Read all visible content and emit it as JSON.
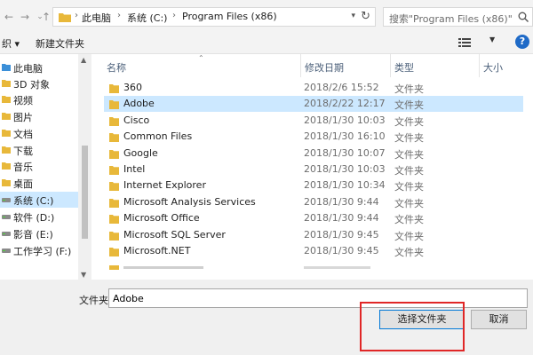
{
  "address": {
    "crumbs": [
      "此电脑",
      "系统 (C:)",
      "Program Files (x86)"
    ],
    "refresh_glyph": "↻"
  },
  "search": {
    "placeholder": "搜索\"Program Files (x86)\""
  },
  "toolbar": {
    "organize_label": "织 ▾",
    "new_folder_label": "新建文件夹",
    "help_glyph": "?"
  },
  "nav": {
    "items": [
      {
        "label": "此电脑",
        "icon": "computer-icon",
        "selected": false
      },
      {
        "label": "3D 对象",
        "icon": "3d-objects-icon",
        "selected": false
      },
      {
        "label": "视频",
        "icon": "video-folder-icon",
        "selected": false
      },
      {
        "label": "图片",
        "icon": "pictures-folder-icon",
        "selected": false
      },
      {
        "label": "文档",
        "icon": "documents-folder-icon",
        "selected": false
      },
      {
        "label": "下载",
        "icon": "downloads-folder-icon",
        "selected": false
      },
      {
        "label": "音乐",
        "icon": "music-folder-icon",
        "selected": false
      },
      {
        "label": "桌面",
        "icon": "desktop-folder-icon",
        "selected": false
      },
      {
        "label": "系统 (C:)",
        "icon": "drive-icon",
        "selected": true
      },
      {
        "label": "软件 (D:)",
        "icon": "drive-icon",
        "selected": false
      },
      {
        "label": "影音 (E:)",
        "icon": "drive-icon",
        "selected": false
      },
      {
        "label": "工作学习 (F:)",
        "icon": "drive-icon",
        "selected": false
      }
    ]
  },
  "list": {
    "columns": {
      "name": "名称",
      "date": "修改日期",
      "type": "类型",
      "size": "大小"
    },
    "rows": [
      {
        "name": "360",
        "date": "2018/2/6 15:52",
        "type": "文件夹",
        "selected": false
      },
      {
        "name": "Adobe",
        "date": "2018/2/22 12:17",
        "type": "文件夹",
        "selected": true
      },
      {
        "name": "Cisco",
        "date": "2018/1/30 10:03",
        "type": "文件夹",
        "selected": false
      },
      {
        "name": "Common Files",
        "date": "2018/1/30 16:10",
        "type": "文件夹",
        "selected": false
      },
      {
        "name": "Google",
        "date": "2018/1/30 10:07",
        "type": "文件夹",
        "selected": false
      },
      {
        "name": "Intel",
        "date": "2018/1/30 10:03",
        "type": "文件夹",
        "selected": false
      },
      {
        "name": "Internet Explorer",
        "date": "2018/1/30 10:34",
        "type": "文件夹",
        "selected": false
      },
      {
        "name": "Microsoft Analysis Services",
        "date": "2018/1/30 9:44",
        "type": "文件夹",
        "selected": false
      },
      {
        "name": "Microsoft Office",
        "date": "2018/1/30 9:44",
        "type": "文件夹",
        "selected": false
      },
      {
        "name": "Microsoft SQL Server",
        "date": "2018/1/30 9:45",
        "type": "文件夹",
        "selected": false
      },
      {
        "name": "Microsoft.NET",
        "date": "2018/1/30 9:45",
        "type": "文件夹",
        "selected": false
      }
    ]
  },
  "bottom": {
    "folder_label": "文件夹:",
    "folder_value": "Adobe",
    "select_button": "选择文件夹",
    "cancel_button": "取消"
  },
  "colors": {
    "selection": "#cce8ff",
    "folder": "#e8b83a",
    "accent": "#0078d7",
    "highlight": "#e02727"
  }
}
